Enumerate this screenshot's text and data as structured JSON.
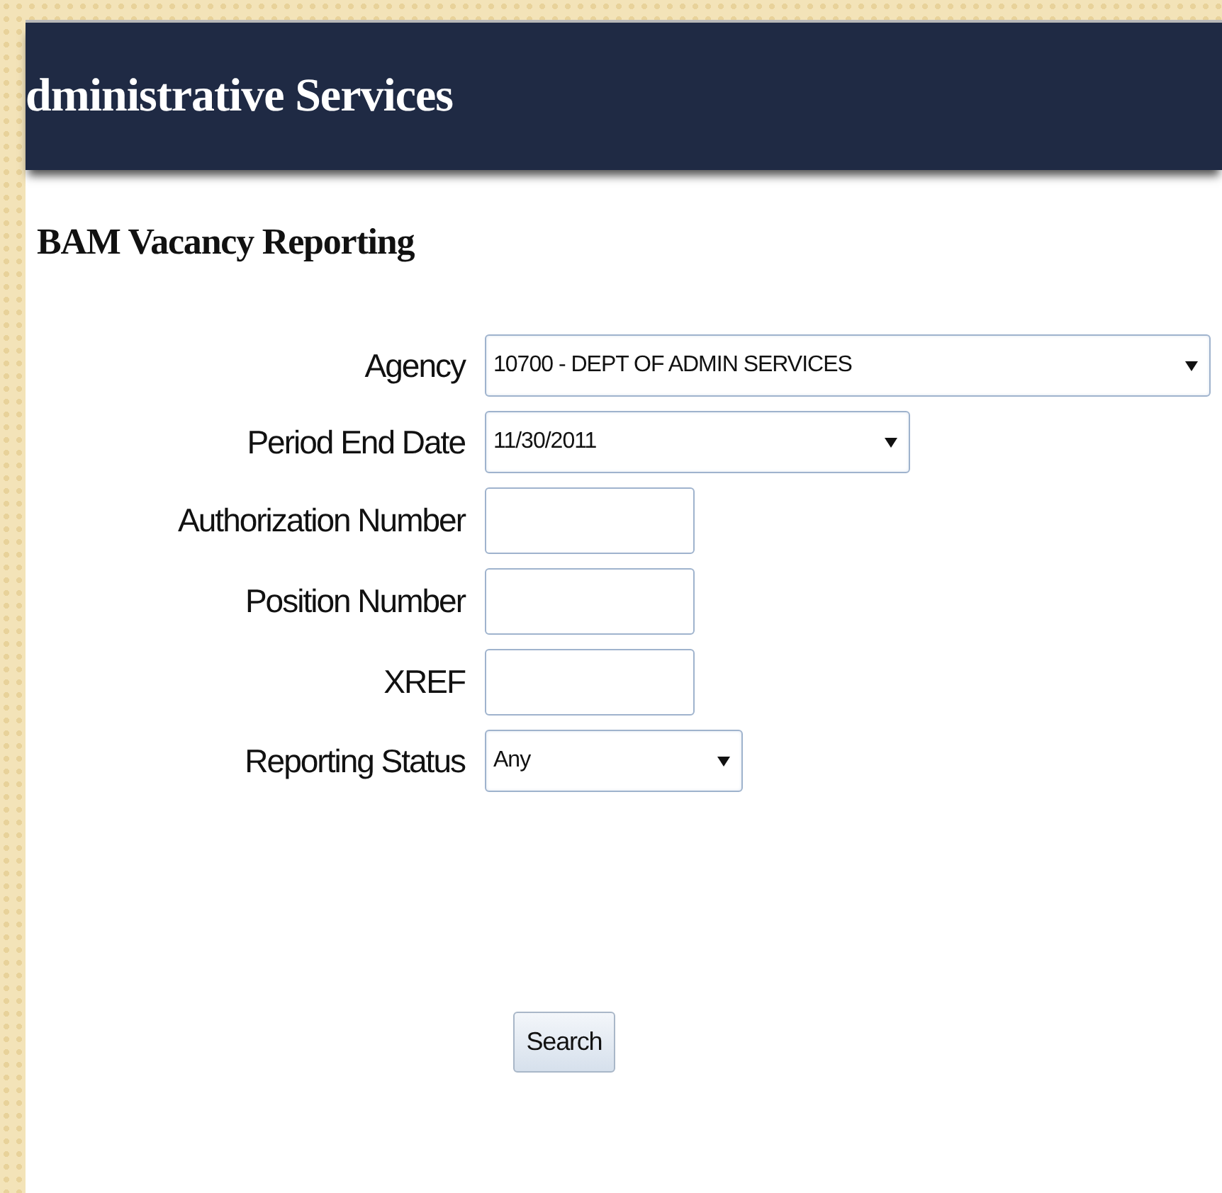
{
  "header": {
    "title": "dministrative Services"
  },
  "page_title": "BAM Vacancy Reporting",
  "fields": [
    {
      "label": "Agency",
      "kind": "select",
      "value": "10700 - DEPT OF ADMIN SERVICES"
    },
    {
      "label": "Period End Date",
      "kind": "select",
      "value": "11/30/2011"
    },
    {
      "label": "Authorization Number",
      "kind": "text"
    },
    {
      "label": "Position Number",
      "kind": "text"
    },
    {
      "label": "XREF",
      "kind": "text"
    },
    {
      "label": "Reporting Status",
      "kind": "select",
      "value": "Any"
    }
  ],
  "button": "Search"
}
